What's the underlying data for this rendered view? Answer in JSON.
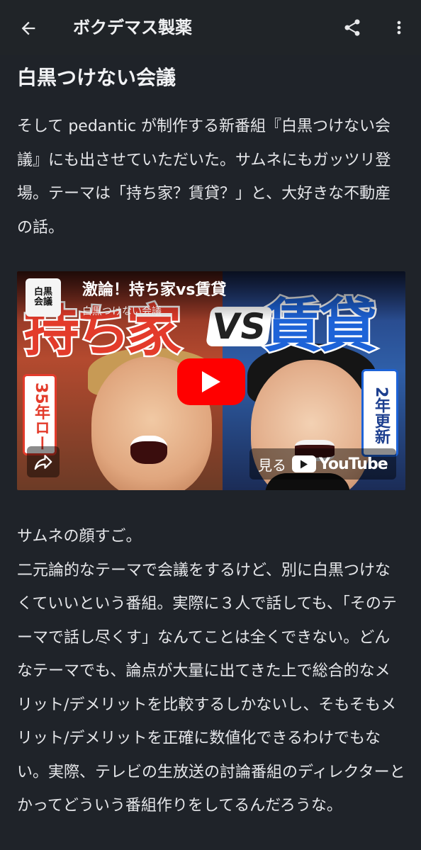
{
  "header": {
    "title": "ボクデマス製薬",
    "back_icon": "arrow-left-icon",
    "share_icon": "share-icon",
    "more_icon": "more-vertical-icon"
  },
  "article": {
    "heading": "白黒つけない会議",
    "paragraph1": "そして pedantic が制作する新番組『白黒つけない会議』にも出させていただいた。サムネにもガッツリ登場。テーマは「持ち家？賃貸？」と、大好きな不動産の話。",
    "paragraph2": "サムネの顔すご。\n二元論的なテーマで会議をするけど、別に白黒つけなくていいという番組。実際に３人で話しても、「そのテーマで話し尽くす」なんてことは全くできない。どんなテーマでも、論点が大量に出てきた上で総合的なメリット/デメリットを比較するしかないし、そもそもメリット/デメリットを正確に数値化できるわけでもない。実際、テレビの生放送の討論番組のディレクターとかってどういう番組作りをしてるんだろうな。"
  },
  "video": {
    "title": "激論！持ち家vs賃貸",
    "channel": "白黒つけない会議",
    "logo_text": "白黒\n会議",
    "thumb_left": "持ち家",
    "thumb_vs": "VS",
    "thumb_right": "賃貸",
    "tag_left": "35年ロー",
    "tag_right": "2年更新",
    "watch_label": "見る",
    "youtube_label": "YouTube",
    "colors": {
      "play": "#ff0000",
      "left": "#e33b2b",
      "right": "#1d63d8"
    }
  }
}
